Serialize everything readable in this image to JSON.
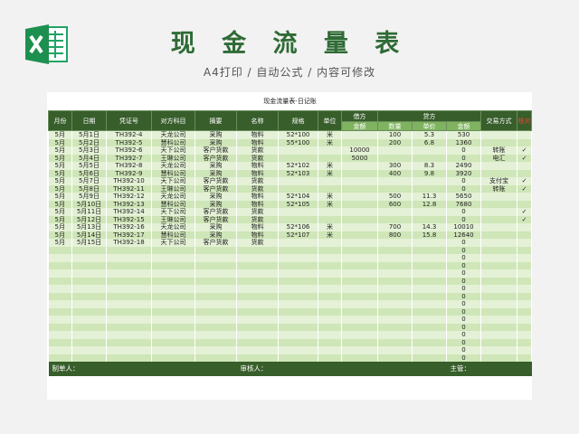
{
  "header": {
    "title": "现 金 流 量 表",
    "subtitle": "A4打印 / 自动公式 / 内容可修改"
  },
  "sheet": {
    "title": "现金流量表-日记账",
    "columns": {
      "month": "月份",
      "date": "日期",
      "voucher": "凭证号",
      "account": "对方科目",
      "summary": "摘要",
      "name": "名称",
      "spec": "规格",
      "unit": "单位",
      "debit": "借方",
      "credit": "贷方",
      "trade": "交易方式",
      "check": "核对"
    },
    "subcolumns": {
      "debit_amount": "金额",
      "qty": "数量",
      "price": "单价",
      "credit_amount": "金额"
    },
    "rows": [
      {
        "month": "5月",
        "date": "5月1日",
        "voucher": "TH392-4",
        "account": "天龙公司",
        "summary": "采购",
        "name": "物料",
        "spec": "52*100",
        "unit": "米",
        "debit": "",
        "qty": "100",
        "price": "5.3",
        "amount": "530",
        "trade": "",
        "check": ""
      },
      {
        "month": "5月",
        "date": "5月2日",
        "voucher": "TH392-5",
        "account": "慧科公司",
        "summary": "采购",
        "name": "物料",
        "spec": "55*100",
        "unit": "米",
        "debit": "",
        "qty": "200",
        "price": "6.8",
        "amount": "1360",
        "trade": "",
        "check": ""
      },
      {
        "month": "5月",
        "date": "5月3日",
        "voucher": "TH392-6",
        "account": "天下公司",
        "summary": "客户货款",
        "name": "货款",
        "spec": "",
        "unit": "",
        "debit": "10000",
        "qty": "",
        "price": "",
        "amount": "0",
        "trade": "转账",
        "check": "✓"
      },
      {
        "month": "5月",
        "date": "5月4日",
        "voucher": "TH392-7",
        "account": "王琳公司",
        "summary": "客户货款",
        "name": "货款",
        "spec": "",
        "unit": "",
        "debit": "5000",
        "qty": "",
        "price": "",
        "amount": "0",
        "trade": "电汇",
        "check": "✓"
      },
      {
        "month": "5月",
        "date": "5月5日",
        "voucher": "TH392-8",
        "account": "天龙公司",
        "summary": "采购",
        "name": "物料",
        "spec": "52*102",
        "unit": "米",
        "debit": "",
        "qty": "300",
        "price": "8.3",
        "amount": "2490",
        "trade": "",
        "check": ""
      },
      {
        "month": "5月",
        "date": "5月6日",
        "voucher": "TH392-9",
        "account": "慧科公司",
        "summary": "采购",
        "name": "物料",
        "spec": "52*103",
        "unit": "米",
        "debit": "",
        "qty": "400",
        "price": "9.8",
        "amount": "3920",
        "trade": "",
        "check": ""
      },
      {
        "month": "5月",
        "date": "5月7日",
        "voucher": "TH392-10",
        "account": "天下公司",
        "summary": "客户货款",
        "name": "货款",
        "spec": "",
        "unit": "",
        "debit": "",
        "qty": "",
        "price": "",
        "amount": "0",
        "trade": "支付宝",
        "check": "✓"
      },
      {
        "month": "5月",
        "date": "5月8日",
        "voucher": "TH392-11",
        "account": "王琳公司",
        "summary": "客户货款",
        "name": "货款",
        "spec": "",
        "unit": "",
        "debit": "",
        "qty": "",
        "price": "",
        "amount": "0",
        "trade": "转账",
        "check": "✓"
      },
      {
        "month": "5月",
        "date": "5月9日",
        "voucher": "TH392-12",
        "account": "天龙公司",
        "summary": "采购",
        "name": "物料",
        "spec": "52*104",
        "unit": "米",
        "debit": "",
        "qty": "500",
        "price": "11.3",
        "amount": "5650",
        "trade": "",
        "check": ""
      },
      {
        "month": "5月",
        "date": "5月10日",
        "voucher": "TH392-13",
        "account": "慧科公司",
        "summary": "采购",
        "name": "物料",
        "spec": "52*105",
        "unit": "米",
        "debit": "",
        "qty": "600",
        "price": "12.8",
        "amount": "7680",
        "trade": "",
        "check": ""
      },
      {
        "month": "5月",
        "date": "5月11日",
        "voucher": "TH392-14",
        "account": "天下公司",
        "summary": "客户货款",
        "name": "货款",
        "spec": "",
        "unit": "",
        "debit": "",
        "qty": "",
        "price": "",
        "amount": "0",
        "trade": "",
        "check": "✓"
      },
      {
        "month": "5月",
        "date": "5月12日",
        "voucher": "TH392-15",
        "account": "王琳公司",
        "summary": "客户货款",
        "name": "货款",
        "spec": "",
        "unit": "",
        "debit": "",
        "qty": "",
        "price": "",
        "amount": "0",
        "trade": "",
        "check": "✓"
      },
      {
        "month": "5月",
        "date": "5月13日",
        "voucher": "TH392-16",
        "account": "天龙公司",
        "summary": "采购",
        "name": "物料",
        "spec": "52*106",
        "unit": "米",
        "debit": "",
        "qty": "700",
        "price": "14.3",
        "amount": "10010",
        "trade": "",
        "check": ""
      },
      {
        "month": "5月",
        "date": "5月14日",
        "voucher": "TH392-17",
        "account": "慧科公司",
        "summary": "采购",
        "name": "物料",
        "spec": "52*107",
        "unit": "米",
        "debit": "",
        "qty": "800",
        "price": "15.8",
        "amount": "12640",
        "trade": "",
        "check": ""
      },
      {
        "month": "5月",
        "date": "5月15日",
        "voucher": "TH392-18",
        "account": "天下公司",
        "summary": "客户货款",
        "name": "货款",
        "spec": "",
        "unit": "",
        "debit": "",
        "qty": "",
        "price": "",
        "amount": "0",
        "trade": "",
        "check": ""
      },
      {
        "month": "",
        "date": "",
        "voucher": "",
        "account": "",
        "summary": "",
        "name": "",
        "spec": "",
        "unit": "",
        "debit": "",
        "qty": "",
        "price": "",
        "amount": "0",
        "trade": "",
        "check": ""
      },
      {
        "month": "",
        "date": "",
        "voucher": "",
        "account": "",
        "summary": "",
        "name": "",
        "spec": "",
        "unit": "",
        "debit": "",
        "qty": "",
        "price": "",
        "amount": "0",
        "trade": "",
        "check": ""
      },
      {
        "month": "",
        "date": "",
        "voucher": "",
        "account": "",
        "summary": "",
        "name": "",
        "spec": "",
        "unit": "",
        "debit": "",
        "qty": "",
        "price": "",
        "amount": "0",
        "trade": "",
        "check": ""
      },
      {
        "month": "",
        "date": "",
        "voucher": "",
        "account": "",
        "summary": "",
        "name": "",
        "spec": "",
        "unit": "",
        "debit": "",
        "qty": "",
        "price": "",
        "amount": "0",
        "trade": "",
        "check": ""
      },
      {
        "month": "",
        "date": "",
        "voucher": "",
        "account": "",
        "summary": "",
        "name": "",
        "spec": "",
        "unit": "",
        "debit": "",
        "qty": "",
        "price": "",
        "amount": "0",
        "trade": "",
        "check": ""
      },
      {
        "month": "",
        "date": "",
        "voucher": "",
        "account": "",
        "summary": "",
        "name": "",
        "spec": "",
        "unit": "",
        "debit": "",
        "qty": "",
        "price": "",
        "amount": "0",
        "trade": "",
        "check": ""
      },
      {
        "month": "",
        "date": "",
        "voucher": "",
        "account": "",
        "summary": "",
        "name": "",
        "spec": "",
        "unit": "",
        "debit": "",
        "qty": "",
        "price": "",
        "amount": "0",
        "trade": "",
        "check": ""
      },
      {
        "month": "",
        "date": "",
        "voucher": "",
        "account": "",
        "summary": "",
        "name": "",
        "spec": "",
        "unit": "",
        "debit": "",
        "qty": "",
        "price": "",
        "amount": "0",
        "trade": "",
        "check": ""
      },
      {
        "month": "",
        "date": "",
        "voucher": "",
        "account": "",
        "summary": "",
        "name": "",
        "spec": "",
        "unit": "",
        "debit": "",
        "qty": "",
        "price": "",
        "amount": "0",
        "trade": "",
        "check": ""
      },
      {
        "month": "",
        "date": "",
        "voucher": "",
        "account": "",
        "summary": "",
        "name": "",
        "spec": "",
        "unit": "",
        "debit": "",
        "qty": "",
        "price": "",
        "amount": "0",
        "trade": "",
        "check": ""
      },
      {
        "month": "",
        "date": "",
        "voucher": "",
        "account": "",
        "summary": "",
        "name": "",
        "spec": "",
        "unit": "",
        "debit": "",
        "qty": "",
        "price": "",
        "amount": "0",
        "trade": "",
        "check": ""
      },
      {
        "month": "",
        "date": "",
        "voucher": "",
        "account": "",
        "summary": "",
        "name": "",
        "spec": "",
        "unit": "",
        "debit": "",
        "qty": "",
        "price": "",
        "amount": "0",
        "trade": "",
        "check": ""
      },
      {
        "month": "",
        "date": "",
        "voucher": "",
        "account": "",
        "summary": "",
        "name": "",
        "spec": "",
        "unit": "",
        "debit": "",
        "qty": "",
        "price": "",
        "amount": "0",
        "trade": "",
        "check": ""
      },
      {
        "month": "",
        "date": "",
        "voucher": "",
        "account": "",
        "summary": "",
        "name": "",
        "spec": "",
        "unit": "",
        "debit": "",
        "qty": "",
        "price": "",
        "amount": "0",
        "trade": "",
        "check": ""
      },
      {
        "month": "",
        "date": "",
        "voucher": "",
        "account": "",
        "summary": "",
        "name": "",
        "spec": "",
        "unit": "",
        "debit": "",
        "qty": "",
        "price": "",
        "amount": "0",
        "trade": "",
        "check": ""
      }
    ],
    "footer": {
      "preparer": "制单人：",
      "reviewer": "审核人：",
      "supervisor": "主管："
    }
  }
}
